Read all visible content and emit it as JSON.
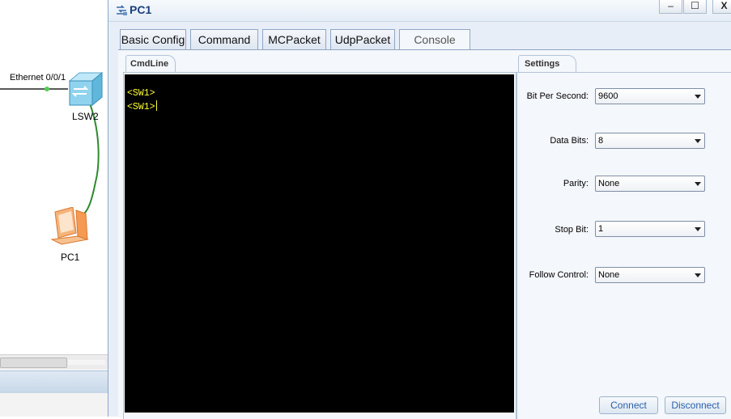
{
  "topology": {
    "interface_label": "Ethernet 0/0/1",
    "switch_label": "LSW2",
    "pc_label": "PC1",
    "switch_icon": "switch-icon",
    "pc_icon": "pc-icon"
  },
  "window": {
    "title": "PC1",
    "icon": "network-adapter-icon",
    "controls": {
      "minimize": "–",
      "maximize": "☐",
      "close": "X"
    }
  },
  "tabs": [
    {
      "label": "Basic Config"
    },
    {
      "label": "Command"
    },
    {
      "label": "MCPacket"
    },
    {
      "label": "UdpPacket"
    },
    {
      "label": "Console",
      "active": true
    }
  ],
  "cmdline": {
    "group_title": "CmdLine",
    "lines": [
      "<SW1>",
      "<SW1>"
    ],
    "text_color": "#ffff33",
    "background": "#000000"
  },
  "settings": {
    "group_title": "Settings",
    "fields": [
      {
        "label": "Bit Per Second:",
        "value": "9600"
      },
      {
        "label": "Data Bits:",
        "value": "8"
      },
      {
        "label": "Parity:",
        "value": "None"
      },
      {
        "label": "Stop Bit:",
        "value": "1"
      },
      {
        "label": "Follow Control:",
        "value": "None"
      }
    ],
    "connect_label": "Connect",
    "disconnect_label": "Disconnect"
  },
  "colors": {
    "accent": "#1c3f78",
    "link_line": "#2e8b2e",
    "button_text": "#2a5fa8"
  }
}
